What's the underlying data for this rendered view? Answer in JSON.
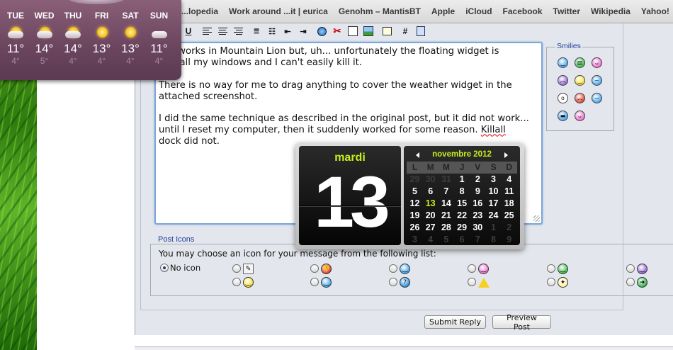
{
  "bookmarks": [
    "...lopedia",
    "Work around ...it | eurica",
    "Genohm – MantisBT",
    "Apple",
    "iCloud",
    "Facebook",
    "Twitter",
    "Wikipedia",
    "Yahoo!"
  ],
  "weather": {
    "days": [
      {
        "name": "TUE",
        "high": "11°",
        "low": "4°",
        "icon": "sun-cloud-icon"
      },
      {
        "name": "WED",
        "high": "14°",
        "low": "5°",
        "icon": "sun-cloud-icon"
      },
      {
        "name": "THU",
        "high": "14°",
        "low": "4°",
        "icon": "sun-cloud-icon"
      },
      {
        "name": "FRI",
        "high": "13°",
        "low": "4°",
        "icon": "sun-icon"
      },
      {
        "name": "SAT",
        "high": "13°",
        "low": "4°",
        "icon": "sun-icon"
      },
      {
        "name": "SUN",
        "high": "11°",
        "low": "4°",
        "icon": "cloud-icon"
      }
    ]
  },
  "toolbar": {
    "underline_label": "U",
    "hash_label": "#"
  },
  "editor": {
    "lines": [
      "still works in Mountain Lion but, uh... unfortunately the floating widget is",
      "p of all my windows and I can't easily kill it.",
      "",
      "There is no way for me to drag anything to cover the weather widget in the",
      "attached screenshot.",
      "",
      "I did the same technique as described in the original post, but it did not work...",
      "until I reset my computer, then it suddenly worked for some reason.",
      "dock did not."
    ],
    "spell_word": "Killall"
  },
  "smilies": {
    "legend": "Smilies",
    "items": [
      {
        "icon": "smile-icon",
        "color": "#4aa8f0"
      },
      {
        "icon": "grin-icon",
        "color": "#3cc34a"
      },
      {
        "icon": "tongue-icon",
        "color": "#f070d0"
      },
      {
        "icon": "sad-icon",
        "color": "#9b6ad8"
      },
      {
        "icon": "wink-icon",
        "color": "#f5e23a"
      },
      {
        "icon": "confused-icon",
        "color": "#4aa8f0"
      },
      {
        "icon": "shocked-icon",
        "color": "#ffffff"
      },
      {
        "icon": "angry-icon",
        "color": "#e84a3a"
      },
      {
        "icon": "dizzy-icon",
        "color": "#4aa8f0"
      },
      {
        "icon": "cool-icon",
        "color": "#4aa8f0"
      },
      {
        "icon": "kiss-icon",
        "color": "#f070d0"
      },
      {
        "icon": "apple-icon",
        "color": "#111111"
      }
    ]
  },
  "post_icons": {
    "legend": "Post Icons",
    "hint": "You may choose an icon for your message from the following list:",
    "no_icon_label": "No icon",
    "row1": [
      "note-icon",
      "thumbs-down-icon",
      "smile-icon",
      "tongue-icon",
      "grin-icon",
      "sad-icon"
    ],
    "row2": [
      "wink-icon",
      "cool-icon",
      "question-icon",
      "warning-icon",
      "lightbulb-icon",
      "arrow-right-icon"
    ]
  },
  "buttons": {
    "submit": "Submit Reply",
    "preview": "Preview Post"
  },
  "calendar": {
    "weekday": "mardi",
    "day": "13",
    "month_label": "novembre 2012",
    "headers": [
      "L",
      "M",
      "M",
      "J",
      "V",
      "S",
      "D"
    ],
    "weeks": [
      [
        "29",
        "30",
        "31",
        "1",
        "2",
        "3",
        "4"
      ],
      [
        "5",
        "6",
        "7",
        "8",
        "9",
        "10",
        "11"
      ],
      [
        "12",
        "13",
        "14",
        "15",
        "16",
        "17",
        "18"
      ],
      [
        "19",
        "20",
        "21",
        "22",
        "23",
        "24",
        "25"
      ],
      [
        "26",
        "27",
        "28",
        "29",
        "30",
        "1",
        "2"
      ],
      [
        "3",
        "4",
        "5",
        "6",
        "7",
        "8",
        "9"
      ]
    ],
    "accent_color": "#c6ef1c"
  }
}
